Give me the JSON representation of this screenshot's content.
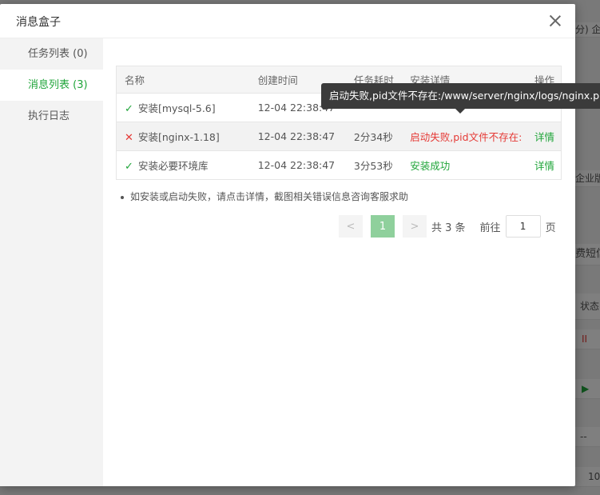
{
  "background": {
    "strip_texts": [
      "分) 企",
      "企业版",
      "费短信",
      "状态",
      "II",
      "▶",
      "--",
      "10"
    ]
  },
  "dialog": {
    "title": "消息盒子",
    "sidebar": [
      {
        "label": "任务列表 (0)",
        "active": false
      },
      {
        "label": "消息列表 (3)",
        "active": true
      },
      {
        "label": "执行日志",
        "active": false
      }
    ],
    "table": {
      "headers": [
        "名称",
        "创建时间",
        "任务耗时",
        "安装详情",
        "操作"
      ],
      "rows": [
        {
          "status": "success",
          "name": "安装[mysql-5.6]",
          "time": "12-04 22:38:47",
          "duration": "",
          "detail": "",
          "action": ""
        },
        {
          "status": "fail",
          "name": "安装[nginx-1.18]",
          "time": "12-04 22:38:47",
          "duration": "2分34秒",
          "detail": "启动失败,pid文件不存在:",
          "action": "详情"
        },
        {
          "status": "success",
          "name": "安装必要环境库",
          "time": "12-04 22:38:47",
          "duration": "3分53秒",
          "detail": "安装成功",
          "action": "详情"
        }
      ]
    },
    "note": "如安装或启动失败，请点击详情，截图相关错误信息咨询客服求助",
    "pagination": {
      "prev": "<",
      "current": "1",
      "next": ">",
      "total_text": "共 3 条",
      "goto_label": "前往",
      "goto_value": "1",
      "page_label": "页"
    },
    "tooltip": "启动失败,pid文件不存在:/www/server/nginx/logs/nginx.pid"
  },
  "colors": {
    "accent": "#20a53a",
    "error": "#e53935"
  }
}
